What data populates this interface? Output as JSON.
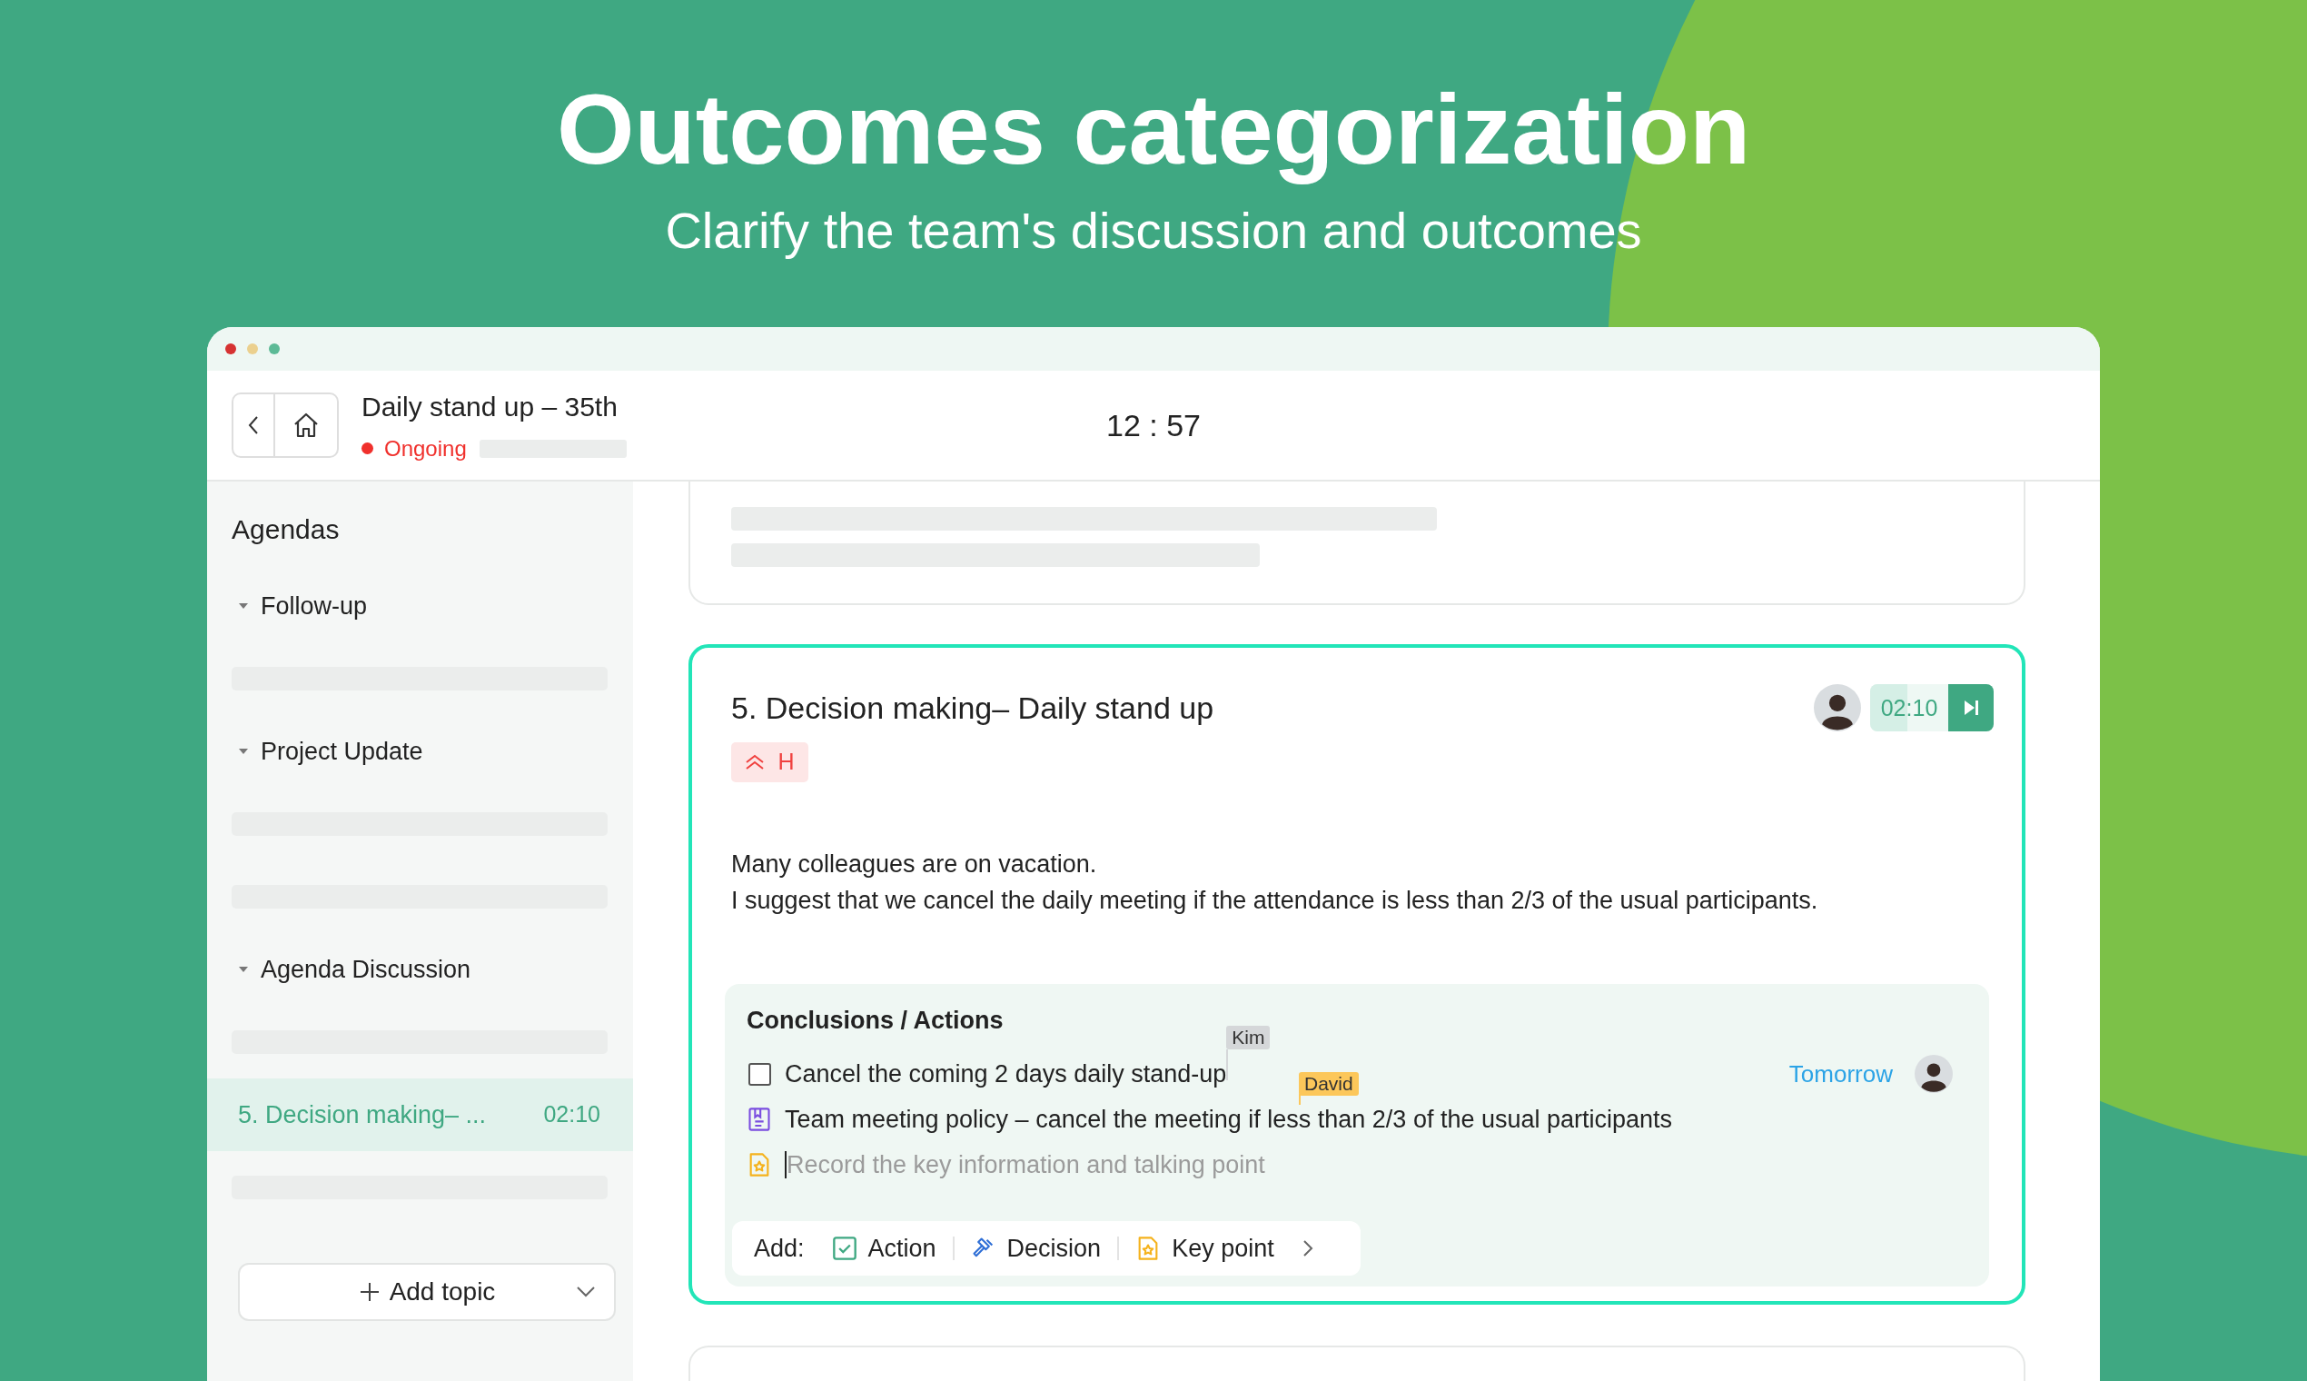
{
  "headline": "Outcomes categorization",
  "subheadline": "Clarify the team's discussion and outcomes",
  "meeting": {
    "title": "Daily stand up – 35th",
    "status": "Ongoing",
    "timer": "12 : 57"
  },
  "sidebar": {
    "heading": "Agendas",
    "groups": [
      {
        "label": "Follow-up",
        "expanded": true,
        "items": [
          {
            "kind": "placeholder"
          }
        ]
      },
      {
        "label": "Project Update",
        "expanded": true,
        "items": [
          {
            "kind": "placeholder"
          },
          {
            "kind": "placeholder"
          }
        ]
      },
      {
        "label": "Agenda Discussion",
        "expanded": true,
        "items": [
          {
            "kind": "placeholder"
          },
          {
            "kind": "topic",
            "label": "5. Decision making– ...",
            "duration": "02:10",
            "selected": true
          },
          {
            "kind": "placeholder"
          }
        ]
      }
    ],
    "add_button": "Add topic"
  },
  "topic": {
    "title": "5. Decision making– Daily stand up",
    "duration": "02:10",
    "level": 0.3,
    "priority": "H",
    "description": [
      "Many colleagues are on vacation.",
      "I suggest that we cancel the daily meeting if the attendance is less than 2/3 of the usual participants."
    ],
    "conclusions": {
      "heading": "Conclusions / Actions",
      "items": [
        {
          "kind": "action",
          "checked": false,
          "text": "Cancel the coming 2 days daily stand-up",
          "collaborator": {
            "name": "Kim",
            "color": "#d5d7d9"
          },
          "due": "Tomorrow"
        },
        {
          "kind": "decision",
          "text": "Team meeting policy – cancel the meeting if less than 2/3 of the usual participants",
          "collaborator": {
            "name": "David",
            "color": "#fcc75a"
          }
        },
        {
          "kind": "key_point",
          "placeholder": "Record the key information and talking point"
        }
      ]
    },
    "add_bar": {
      "label": "Add:",
      "options": [
        {
          "kind": "action",
          "label": "Action"
        },
        {
          "kind": "decision",
          "label": "Decision"
        },
        {
          "kind": "key_point",
          "label": "Key point"
        }
      ]
    }
  }
}
